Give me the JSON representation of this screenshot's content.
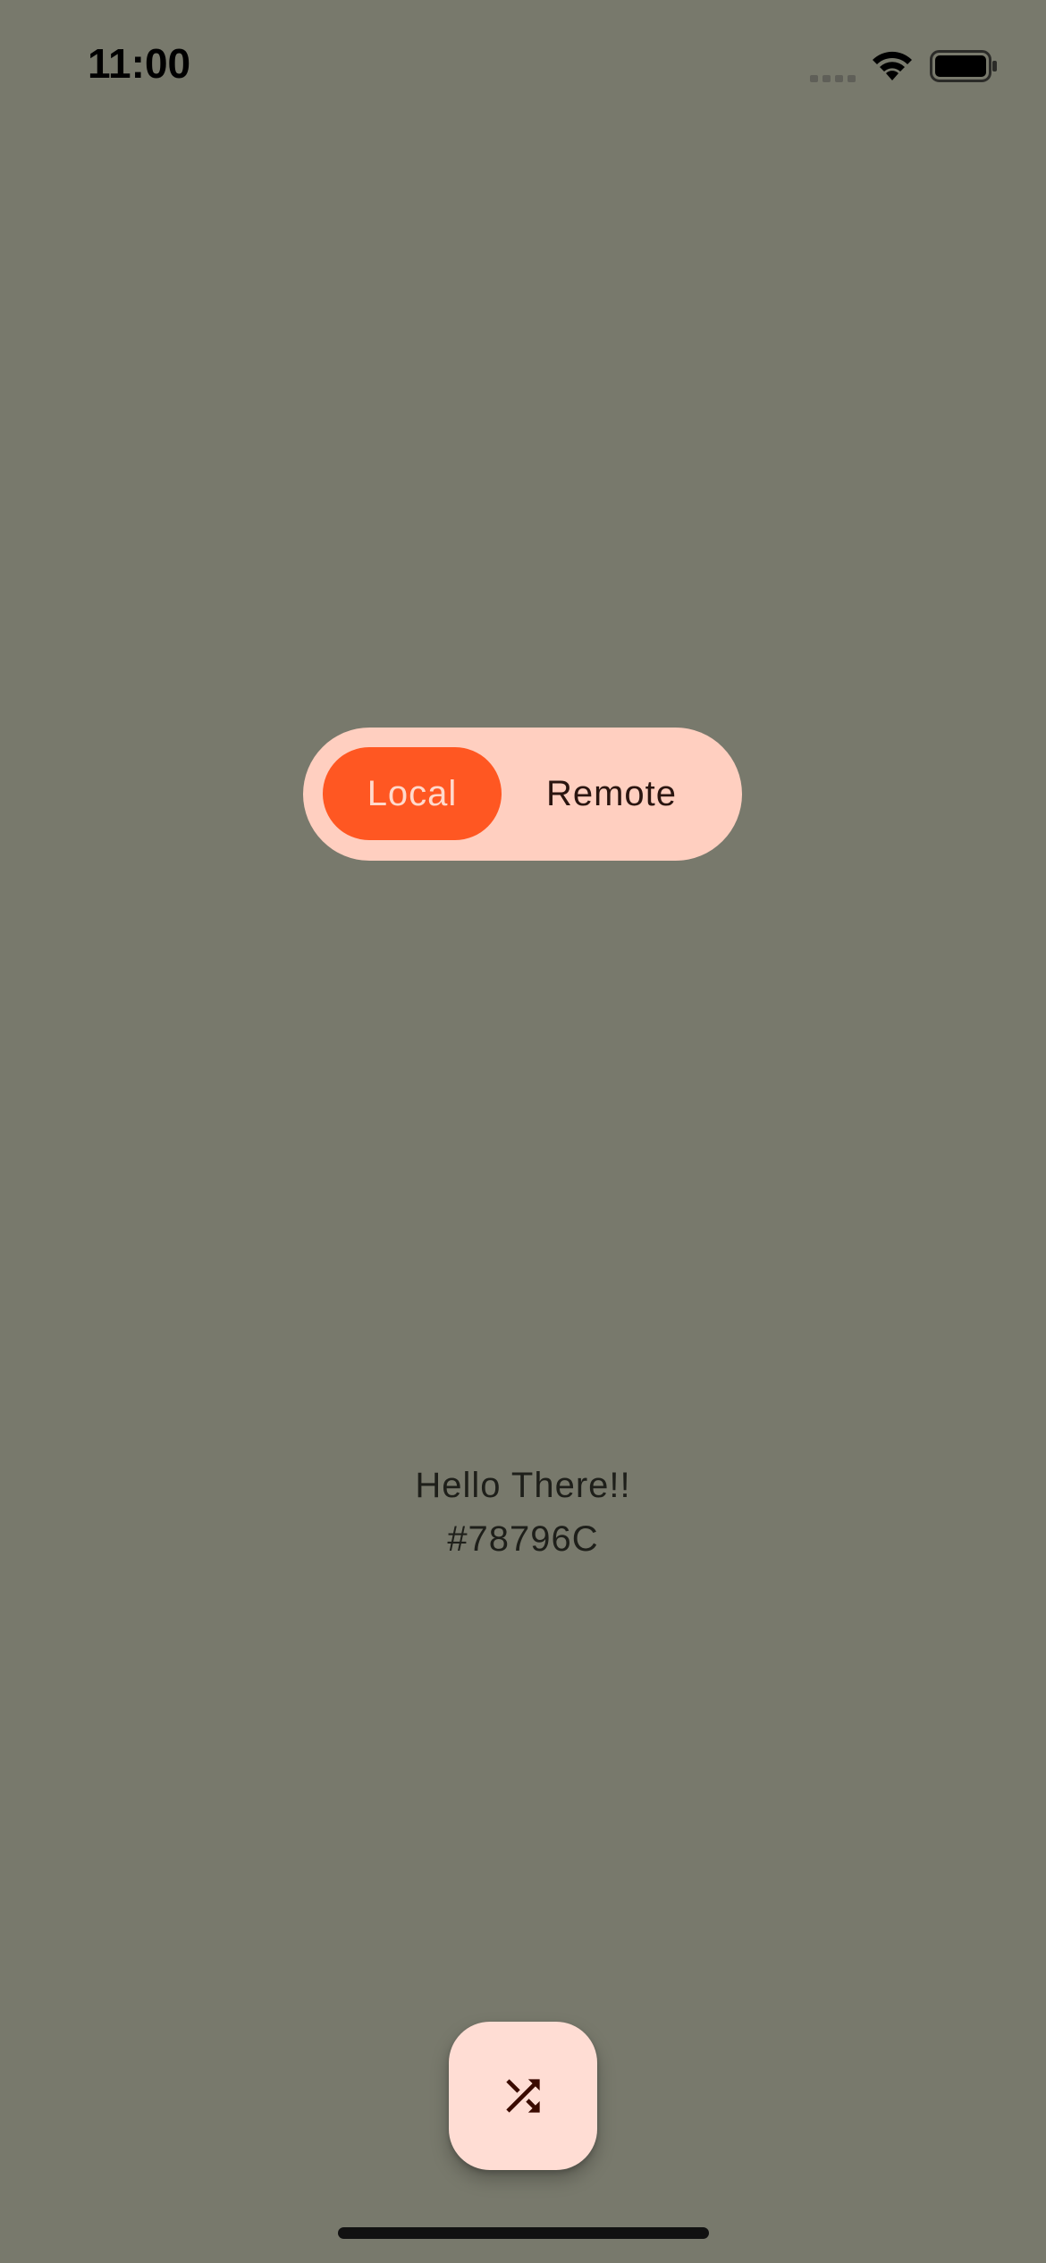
{
  "status_bar": {
    "time": "11:00",
    "icons": [
      "cellular-signal-icon",
      "wifi-icon",
      "battery-icon"
    ]
  },
  "toggle": {
    "options": [
      "Local",
      "Remote"
    ],
    "selected": "Local"
  },
  "content": {
    "greeting": "Hello There!!",
    "color_hex": "#78796C"
  },
  "fab": {
    "icon": "shuffle-icon"
  },
  "colors": {
    "background": "#78796C",
    "accent": "#FF5722",
    "toggle_track": "#FFCFC0",
    "fab_background": "#FFDDD4"
  }
}
